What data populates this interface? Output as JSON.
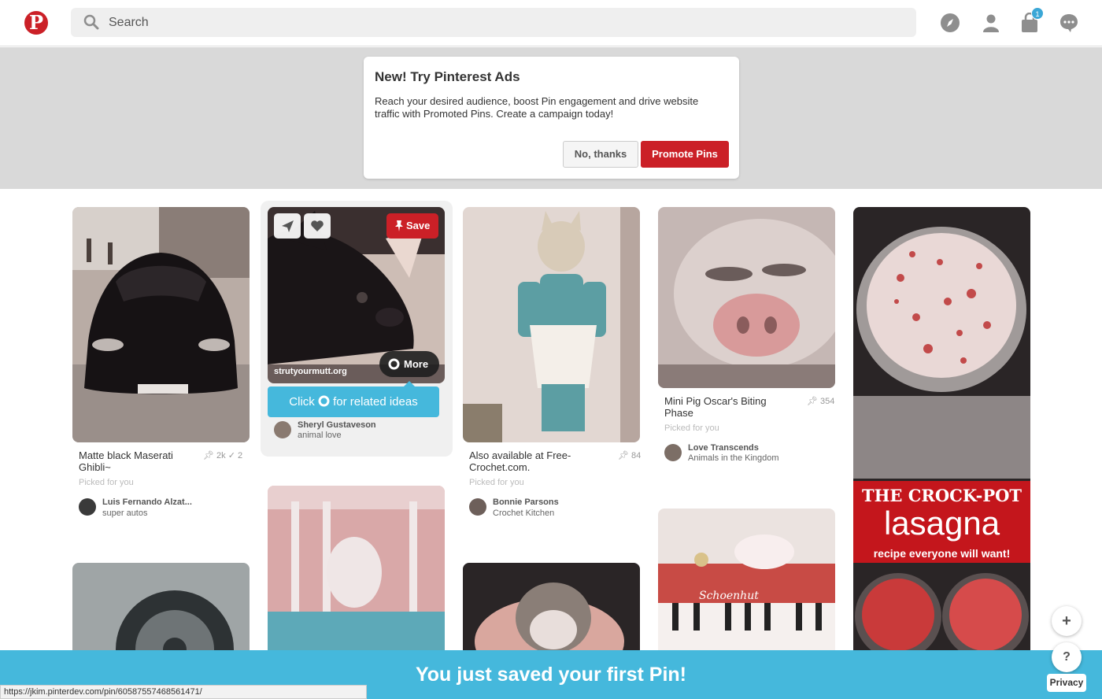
{
  "header": {
    "logo_letter": "P",
    "search_placeholder": "Search",
    "notification_count": "1",
    "icons": [
      "explore-icon",
      "profile-icon",
      "notifications-icon",
      "messages-icon"
    ]
  },
  "ad_prompt": {
    "title": "New! Try Pinterest Ads",
    "body": "Reach your desired audience, boost Pin engagement and drive website traffic with Promoted Pins. Create a campaign today!",
    "decline_label": "No, thanks",
    "promote_label": "Promote Pins"
  },
  "pins": [
    {
      "title": "Matte black Maserati Ghibli~",
      "saves": "2k",
      "tried": "2",
      "picked": "Picked for you",
      "pinner": "Luis Fernando Alzat...",
      "board": "super autos"
    },
    {
      "domain": "strutyourmutt.org",
      "save_label": "Save",
      "more_label": "More",
      "tip_prefix": "Click",
      "tip_suffix": "for related ideas",
      "pinner": "Sheryl Gustaveson",
      "board": "animal love"
    },
    {
      "title": "Also available at Free-Crochet.com.",
      "saves": "84",
      "picked": "Picked for you",
      "pinner": "Bonnie Parsons",
      "board": "Crochet Kitchen"
    },
    {
      "title": "Mini Pig Oscar's Biting Phase",
      "saves": "354",
      "picked": "Picked for you",
      "pinner": "Love Transcends",
      "board": "Animals in the Kingdom"
    },
    {
      "overlay_line1": "THE CROCK-POT",
      "overlay_line2": "lasagna",
      "overlay_line3": "recipe everyone will want!"
    }
  ],
  "piano_label": "Schoenhut",
  "banner": "You just saved your first Pin!",
  "status_url": "https://jkim.pinterdev.com/pin/605875574685614​71/",
  "add_button": "+",
  "help_button": "?",
  "privacy_label": "Privacy",
  "colors": {
    "brand_red": "#cb2027",
    "accent_blue": "#45b8dc"
  }
}
